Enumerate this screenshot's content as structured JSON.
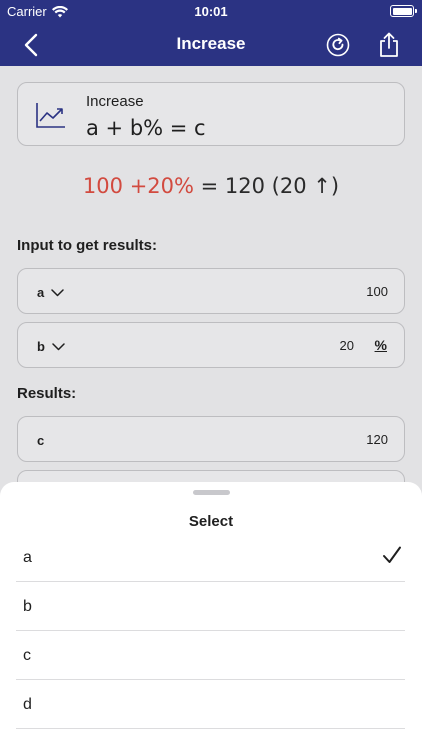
{
  "status": {
    "carrier": "Carrier",
    "time": "10:01"
  },
  "nav": {
    "title": "Increase",
    "back_icon": "chevron-left-icon",
    "refresh_icon": "refresh-icon",
    "share_icon": "share-icon"
  },
  "formula": {
    "title": "Increase",
    "expression": "a + b% = c",
    "icon": "trending-up-icon"
  },
  "example": {
    "a": "100",
    "b": "+20%",
    "rest": "= 120 (20 ↑)"
  },
  "inputs": {
    "label": "Input to get results:",
    "fields": [
      {
        "name": "a",
        "value": "100",
        "unit": ""
      },
      {
        "name": "b",
        "value": "20",
        "unit": "%"
      }
    ]
  },
  "results": {
    "label": "Results:",
    "fields": [
      {
        "name": "c",
        "value": "120"
      }
    ]
  },
  "sheet": {
    "title": "Select",
    "options": [
      "a",
      "b",
      "c",
      "d"
    ],
    "selected": "a"
  },
  "colors": {
    "nav": "#2b3383",
    "highlight": "#d24a3f"
  }
}
